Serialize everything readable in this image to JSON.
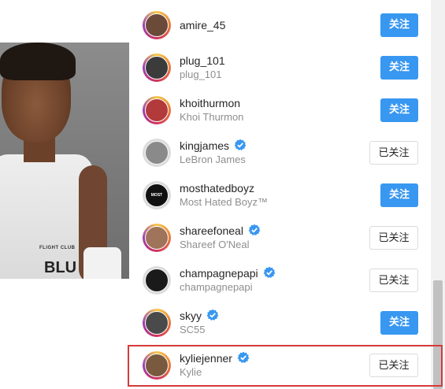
{
  "follow_list": {
    "users": [
      {
        "username": "amire_45",
        "full_name": "",
        "verified": false,
        "button": "关注",
        "state": "follow",
        "avatar_color": "#6b4a3a",
        "ring": true
      },
      {
        "username": "plug_101",
        "full_name": "plug_101",
        "verified": false,
        "button": "关注",
        "state": "follow",
        "avatar_color": "#3b3b3b",
        "ring": true
      },
      {
        "username": "khoithurmon",
        "full_name": "Khoi Thurmon",
        "verified": false,
        "button": "关注",
        "state": "follow",
        "avatar_color": "#b33a3a",
        "ring": true
      },
      {
        "username": "kingjames",
        "full_name": "LeBron James",
        "verified": true,
        "button": "已关注",
        "state": "following",
        "avatar_color": "#8a8a8a",
        "ring": false
      },
      {
        "username": "mosthatedboyz",
        "full_name": "Most Hated Boyz™",
        "verified": false,
        "button": "关注",
        "state": "follow",
        "avatar_color": "#111111",
        "ring": false,
        "avatar_text": "MOST HATED"
      },
      {
        "username": "shareefoneal",
        "full_name": "Shareef O'Neal",
        "verified": true,
        "button": "已关注",
        "state": "following",
        "avatar_color": "#a0745a",
        "ring": true
      },
      {
        "username": "champagnepapi",
        "full_name": "champagnepapi",
        "verified": true,
        "button": "已关注",
        "state": "following",
        "avatar_color": "#1a1a1a",
        "ring": false
      },
      {
        "username": "skyy",
        "full_name": "SC55",
        "verified": true,
        "button": "关注",
        "state": "follow",
        "avatar_color": "#4a4a4a",
        "ring": true
      },
      {
        "username": "kyliejenner",
        "full_name": "Kylie",
        "verified": true,
        "button": "已关注",
        "state": "following",
        "avatar_color": "#7a5a3e",
        "ring": true
      }
    ]
  },
  "photo": {
    "shirt_brand": "FLIGHT CLUB",
    "shirt_text": "BLU"
  },
  "colors": {
    "follow_blue": "#3897f0",
    "verified_blue": "#3897f0",
    "highlight_red": "#d63a3a"
  }
}
